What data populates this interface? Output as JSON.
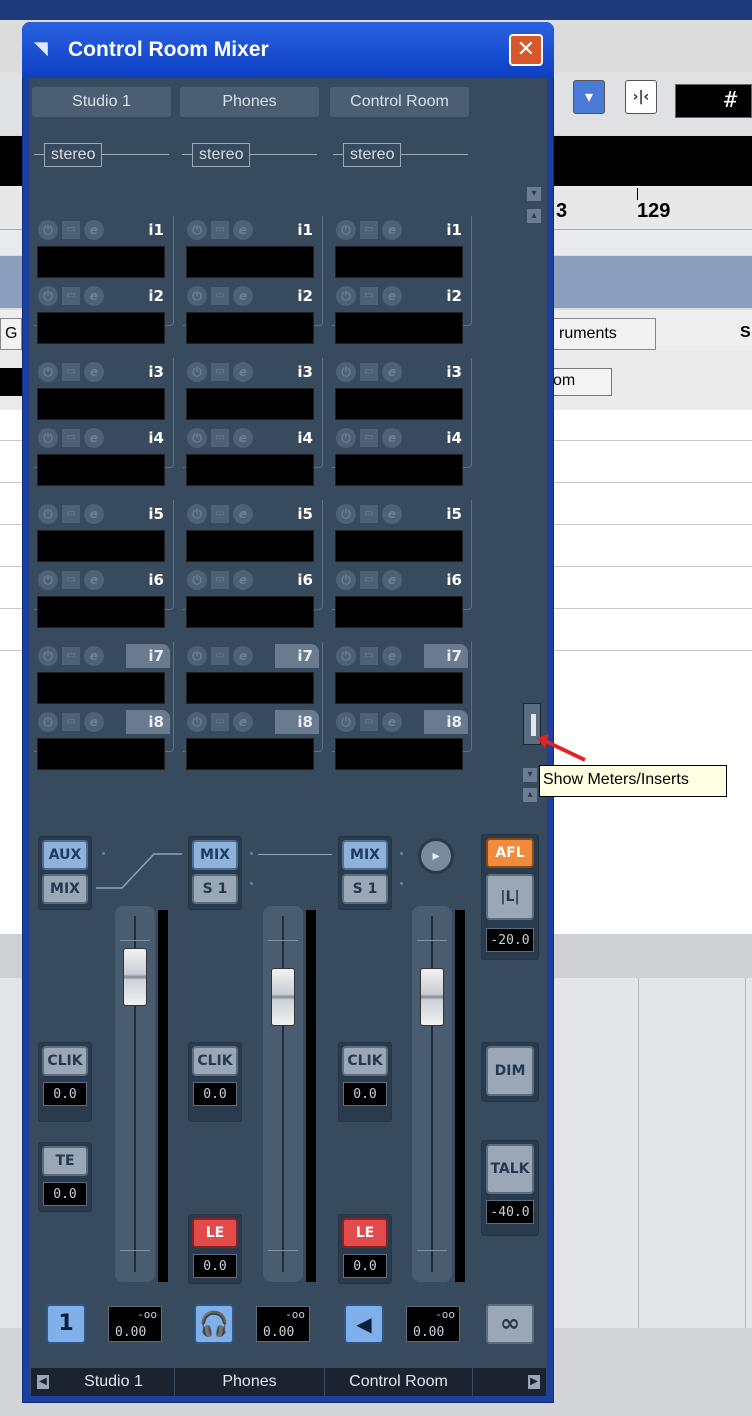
{
  "window": {
    "title": "Control Room Mixer",
    "close": "✕"
  },
  "outputs": [
    {
      "name": "Studio 1",
      "format": "stereo"
    },
    {
      "name": "Phones",
      "format": "stereo"
    },
    {
      "name": "Control Room",
      "format": "stereo"
    }
  ],
  "inserts": [
    "i1",
    "i2",
    "i3",
    "i4",
    "i5",
    "i6",
    "i7",
    "i8"
  ],
  "insert_icons": {
    "power": "power-icon",
    "bypass": "bypass-icon",
    "edit": "edit-icon"
  },
  "tooltip": "Show Meters/Inserts",
  "channels": {
    "studio": {
      "src_top": "AUX",
      "src_bottom": "MIX",
      "clik": "CLIK",
      "clik_val": "0.0",
      "te": "TE",
      "te_val": "0.0",
      "out_btn": "1",
      "out_top": "-oo",
      "out_bot": "0.00"
    },
    "phones": {
      "src_top": "MIX",
      "src_bottom": "S 1",
      "clik": "CLIK",
      "clik_val": "0.0",
      "le": "LE",
      "le_val": "0.0",
      "out_top": "-oo",
      "out_bot": "0.00"
    },
    "control": {
      "src_top": "MIX",
      "src_bottom": "S 1",
      "clik": "CLIK",
      "clik_val": "0.0",
      "le": "LE",
      "le_val": "0.0",
      "out_top": "-oo",
      "out_bot": "0.00"
    }
  },
  "master": {
    "afl": "AFL",
    "lr": "|L|",
    "afl_val": "-20.0",
    "dim": "DIM",
    "talk": "TALK",
    "talk_val": "-40.0",
    "link": "∞"
  },
  "footer": [
    "Studio 1",
    "Phones",
    "Control Room"
  ],
  "background": {
    "ruler": [
      "3",
      "129"
    ],
    "tabs": [
      "G",
      "ruments",
      "S"
    ],
    "button_om": "om",
    "display": "#"
  },
  "colors": {
    "accent_blue": "#7fb0ea",
    "afl_orange": "#f08a3c",
    "listen_red": "#e34a4a",
    "panel": "#384a5e"
  }
}
